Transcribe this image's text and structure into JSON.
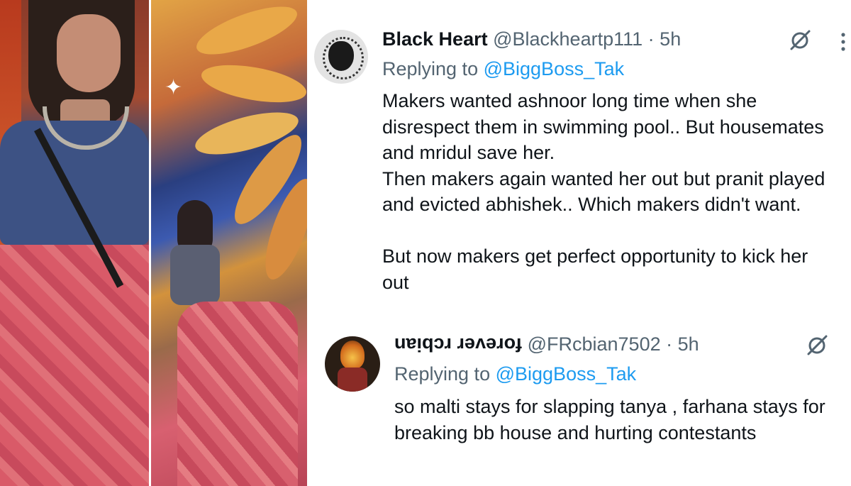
{
  "tweet1": {
    "author_name": "Black Heart",
    "handle": "@Blackheartp111",
    "separator": "·",
    "time": "5h",
    "replying_prefix": "Replying to",
    "replying_to": "@BiggBoss_Tak",
    "lines": [
      "Makers wanted ashnoor long time when she",
      "disrespect them in swimming pool..  But housemates",
      "and mridul save her.",
      "Then makers again wanted her out but pranit played",
      "and evicted abhishek.. Which makers didn't want.",
      "",
      "But now makers get perfect opportunity to kick her",
      "out"
    ],
    "avatar_icon": "black-heart-avatar",
    "action_icons": [
      "grok-icon",
      "more-icon"
    ]
  },
  "tweet2": {
    "author_name": "forever rcbian",
    "handle": "@FRcbian7502",
    "separator": "·",
    "time": "5h",
    "replying_prefix": "Replying to",
    "replying_to": "@BiggBoss_Tak",
    "lines": [
      "so malti stays for slapping tanya , farhana stays for",
      "breaking bb house and hurting contestants"
    ],
    "avatar_icon": "flame-avatar",
    "action_icons": [
      "grok-icon"
    ]
  },
  "colors": {
    "text_primary": "#0f1419",
    "text_secondary": "#536471",
    "link": "#1d9bf0"
  }
}
